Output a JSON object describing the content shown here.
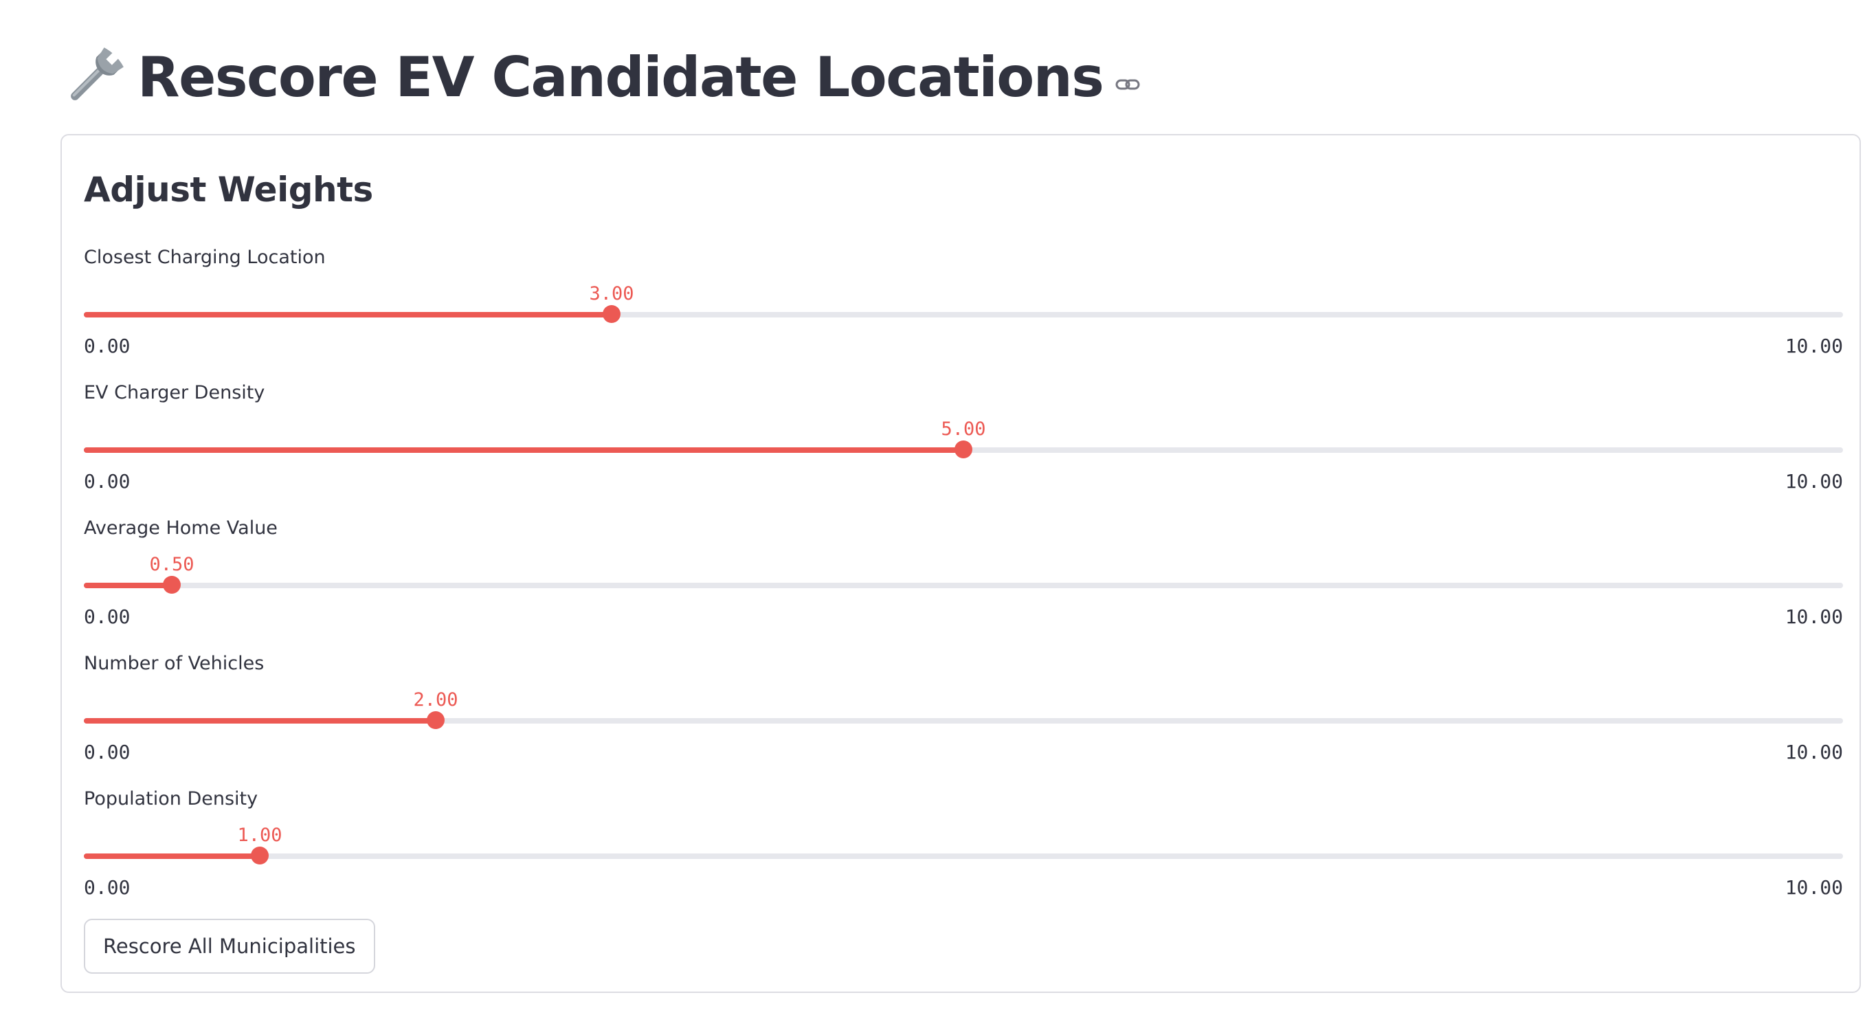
{
  "header": {
    "title": "Rescore EV Candidate Locations",
    "title_icon": "wrench-icon",
    "anchor_icon": "link-icon"
  },
  "form": {
    "section_title": "Adjust Weights",
    "submit_label": "Rescore All Municipalities",
    "accent_color": "#ec5953"
  },
  "sliders": [
    {
      "label": "Closest Charging Location",
      "value": 3.0,
      "value_text": "3.00",
      "min": 0,
      "max": 10,
      "min_text": "0.00",
      "max_text": "10.00"
    },
    {
      "label": "EV Charger Density",
      "value": 5.0,
      "value_text": "5.00",
      "min": 0,
      "max": 10,
      "min_text": "0.00",
      "max_text": "10.00"
    },
    {
      "label": "Average Home Value",
      "value": 0.5,
      "value_text": "0.50",
      "min": 0,
      "max": 10,
      "min_text": "0.00",
      "max_text": "10.00"
    },
    {
      "label": "Number of Vehicles",
      "value": 2.0,
      "value_text": "2.00",
      "min": 0,
      "max": 10,
      "min_text": "0.00",
      "max_text": "10.00"
    },
    {
      "label": "Population Density",
      "value": 1.0,
      "value_text": "1.00",
      "min": 0,
      "max": 10,
      "min_text": "0.00",
      "max_text": "10.00"
    }
  ]
}
